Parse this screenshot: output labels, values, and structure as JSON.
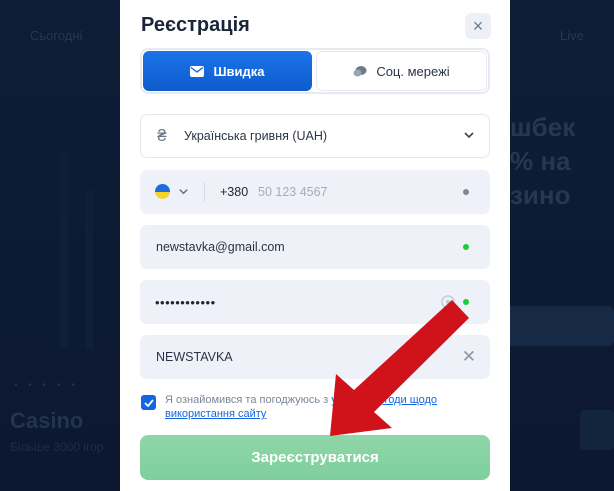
{
  "background": {
    "top_links": [
      "Сьогодні",
      "Live"
    ],
    "promo_text": "шбек\n% на\nзино",
    "casino_title": "Casino",
    "casino_subtitle": "Більше 3000 ігор"
  },
  "modal": {
    "title": "Реєстрація",
    "close_icon": "close-icon",
    "tabs": [
      {
        "label": "Швидка",
        "icon": "envelope-icon",
        "active": true
      },
      {
        "label": "Соц. мережі",
        "icon": "chat-bubble-icon",
        "active": false
      }
    ],
    "currency": {
      "sign": "₴",
      "value": "Українська гривня (UAH)"
    },
    "phone": {
      "prefix": "+380",
      "placeholder": "50 123 4567",
      "country": "UA"
    },
    "email": {
      "value": "newstavka@gmail.com"
    },
    "password": {
      "value": "••••••••••••"
    },
    "promo_code": {
      "value": "NEWSTAVKA"
    },
    "agreement": {
      "prefix": "Я ознайомився та погоджуюсь з ",
      "link": "умовами угоди щодо використання сайту",
      "checked": true
    },
    "submit_label": "Зареєструватися"
  },
  "colors": {
    "accent": "#1466e0",
    "success": "#1ecb3d",
    "submit": "#8fd6a8",
    "arrow": "#d0121b"
  }
}
